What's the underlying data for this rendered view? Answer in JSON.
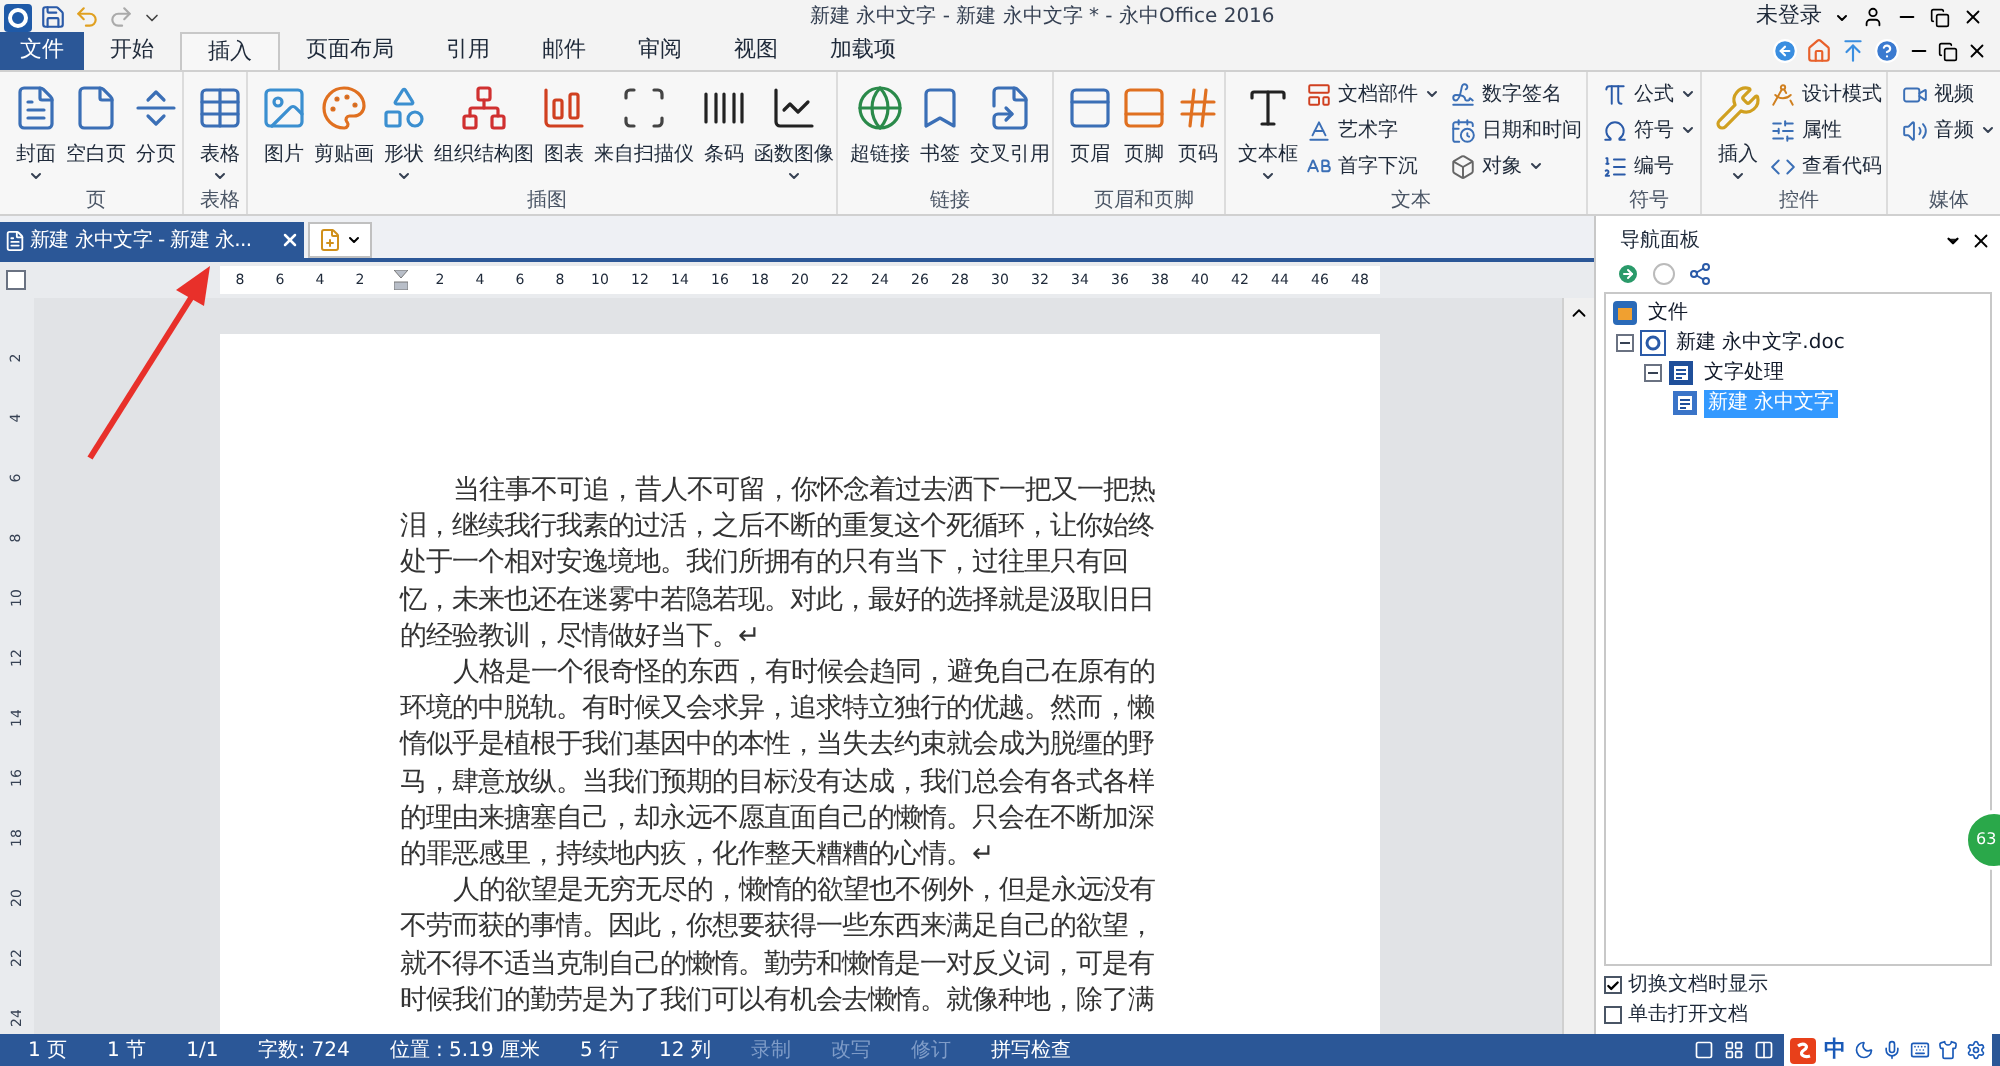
{
  "window": {
    "title": "新建 永中文字 - 新建 永中文字 * - 永中Office 2016",
    "account": "未登录"
  },
  "menu_tabs": [
    {
      "label": "文件",
      "kind": "file",
      "selected": false
    },
    {
      "label": "开始",
      "kind": "tab",
      "selected": false
    },
    {
      "label": "插入",
      "kind": "tab",
      "selected": true
    },
    {
      "label": "页面布局",
      "kind": "tab",
      "selected": false
    },
    {
      "label": "引用",
      "kind": "tab",
      "selected": false
    },
    {
      "label": "邮件",
      "kind": "tab",
      "selected": false
    },
    {
      "label": "审阅",
      "kind": "tab",
      "selected": false
    },
    {
      "label": "视图",
      "kind": "tab",
      "selected": false
    },
    {
      "label": "加载项",
      "kind": "tab",
      "selected": false
    }
  ],
  "ribbon": {
    "groups": [
      {
        "label": "页",
        "columns": [
          [
            {
              "kind": "large",
              "label": "封面",
              "dropdown": true
            }
          ],
          [
            {
              "kind": "large",
              "label": "空白页",
              "dropdown": false
            }
          ],
          [
            {
              "kind": "large",
              "label": "分页",
              "dropdown": false
            }
          ]
        ]
      },
      {
        "label": "表格",
        "columns": [
          [
            {
              "kind": "large",
              "label": "表格",
              "dropdown": true
            }
          ]
        ]
      },
      {
        "label": "插图",
        "columns": [
          [
            {
              "kind": "large",
              "label": "图片",
              "dropdown": false
            }
          ],
          [
            {
              "kind": "large",
              "label": "剪贴画",
              "dropdown": false
            }
          ],
          [
            {
              "kind": "large",
              "label": "形状",
              "dropdown": true
            }
          ],
          [
            {
              "kind": "large",
              "label": "组织结构图",
              "dropdown": false
            }
          ],
          [
            {
              "kind": "large",
              "label": "图表",
              "dropdown": false
            }
          ],
          [
            {
              "kind": "large",
              "label": "来自扫描仪",
              "dropdown": false
            }
          ],
          [
            {
              "kind": "large",
              "label": "条码",
              "dropdown": false
            }
          ],
          [
            {
              "kind": "large",
              "label": "函数图像",
              "dropdown": true
            }
          ]
        ]
      },
      {
        "label": "链接",
        "columns": [
          [
            {
              "kind": "large",
              "label": "超链接",
              "dropdown": false
            }
          ],
          [
            {
              "kind": "large",
              "label": "书签",
              "dropdown": false
            }
          ],
          [
            {
              "kind": "large",
              "label": "交叉引用",
              "dropdown": false
            }
          ]
        ]
      },
      {
        "label": "页眉和页脚",
        "columns": [
          [
            {
              "kind": "large",
              "label": "页眉",
              "dropdown": false
            }
          ],
          [
            {
              "kind": "large",
              "label": "页脚",
              "dropdown": false
            }
          ],
          [
            {
              "kind": "large",
              "label": "页码",
              "dropdown": false
            }
          ]
        ]
      },
      {
        "label": "文本",
        "columns": [
          [
            {
              "kind": "large",
              "label": "文本框",
              "dropdown": true
            }
          ],
          [
            {
              "kind": "small",
              "label": "文档部件",
              "dropdown": true
            },
            {
              "kind": "small",
              "label": "艺术字",
              "dropdown": false
            },
            {
              "kind": "small",
              "label": "首字下沉",
              "dropdown": false
            }
          ],
          [
            {
              "kind": "small",
              "label": "数字签名",
              "dropdown": false
            },
            {
              "kind": "small",
              "label": "日期和时间",
              "dropdown": false
            },
            {
              "kind": "small",
              "label": "对象",
              "dropdown": true
            }
          ]
        ]
      },
      {
        "label": "符号",
        "columns": [
          [
            {
              "kind": "small",
              "label": "公式",
              "dropdown": true
            },
            {
              "kind": "small",
              "label": "符号",
              "dropdown": true
            },
            {
              "kind": "small",
              "label": "编号",
              "dropdown": false
            }
          ]
        ]
      },
      {
        "label": "控件",
        "columns": [
          [
            {
              "kind": "large",
              "label": "插入",
              "dropdown": true
            }
          ],
          [
            {
              "kind": "small",
              "label": "设计模式",
              "dropdown": false
            },
            {
              "kind": "small",
              "label": "属性",
              "dropdown": false
            },
            {
              "kind": "small",
              "label": "查看代码",
              "dropdown": false
            }
          ]
        ]
      },
      {
        "label": "媒体",
        "columns": [
          [
            {
              "kind": "small",
              "label": "视频",
              "dropdown": false
            },
            {
              "kind": "small",
              "label": "音频",
              "dropdown": true
            }
          ]
        ]
      }
    ]
  },
  "document_tabs": [
    {
      "label": "新建 永中文字 - 新建 永...",
      "selected": true
    }
  ],
  "ruler": {
    "left_ticks": [
      "8",
      "6",
      "4",
      "2"
    ],
    "right_ticks": [
      "2",
      "4",
      "6",
      "8",
      "10",
      "12",
      "14",
      "16",
      "18",
      "20",
      "22",
      "24",
      "26",
      "28",
      "30",
      "32",
      "34",
      "36",
      "38",
      "40",
      "42",
      "44",
      "46",
      "48"
    ]
  },
  "vertical_ruler": [
    "2",
    "4",
    "6",
    "8",
    "10",
    "12",
    "14",
    "16",
    "18",
    "20",
    "22",
    "24"
  ],
  "document": {
    "paragraphs": [
      "当往事不可追，昔人不可留，你怀念着过去洒下一把又一把热泪，继续我行我素的过活，之后不断的重复这个死循环，让你始终处于一个相对安逸境地。我们所拥有的只有当下，过往里只有回忆，未来也还在迷雾中若隐若现。对此，最好的选择就是汲取旧日的经验教训，尽情做好当下。↵",
      "人格是一个很奇怪的东西，有时候会趋同，避免自己在原有的环境的中脱轨。有时候又会求异，追求特立独行的优越。然而，懒惰似乎是植根于我们基因中的本性，当失去约束就会成为脱缰的野马，肆意放纵。当我们预期的目标没有达成，我们总会有各式各样的理由来搪塞自己，却永远不愿直面自己的懒惰。只会在不断加深的罪恶感里，持续地内疚，化作整天糟糟的心情。↵",
      "人的欲望是无穷无尽的，懒惰的欲望也不例外，但是永远没有不劳而获的事情。因此，你想要获得一些东西来满足自己的欲望，就不得不适当克制自己的懒惰。勤劳和懒惰是一对反义词，可是有时候我们的勤劳是为了我们可以有机会去懒惰。就像种地，除了满"
    ]
  },
  "navigation_panel": {
    "title": "导航面板",
    "tree": [
      {
        "label": "文件",
        "kind": "root",
        "selected": false,
        "children": [
          {
            "label": "新建 永中文字.doc",
            "kind": "file",
            "expanded": true,
            "selected": false,
            "children": [
              {
                "label": "文字处理",
                "kind": "app",
                "expanded": true,
                "selected": false,
                "children": [
                  {
                    "label": "新建 永中文字",
                    "kind": "doc",
                    "selected": true
                  }
                ]
              }
            ]
          }
        ]
      }
    ],
    "options": [
      {
        "label": "切换文档时显示",
        "checked": true
      },
      {
        "label": "单击打开文档",
        "checked": false
      }
    ]
  },
  "floating_badge": "63",
  "status_bar": {
    "items": [
      {
        "label": "1 页",
        "disabled": false
      },
      {
        "label": "1 节",
        "disabled": false
      },
      {
        "label": "1/1",
        "disabled": false
      },
      {
        "label": "字数: 724",
        "disabled": false
      },
      {
        "label": "位置 : 5.19 厘米",
        "disabled": false
      },
      {
        "label": "5 行",
        "disabled": false
      },
      {
        "label": "12 列",
        "disabled": false
      },
      {
        "label": "录制",
        "disabled": true
      },
      {
        "label": "改写",
        "disabled": true
      },
      {
        "label": "修订",
        "disabled": true
      },
      {
        "label": "拼写检查",
        "disabled": false
      }
    ],
    "ime": "中"
  }
}
